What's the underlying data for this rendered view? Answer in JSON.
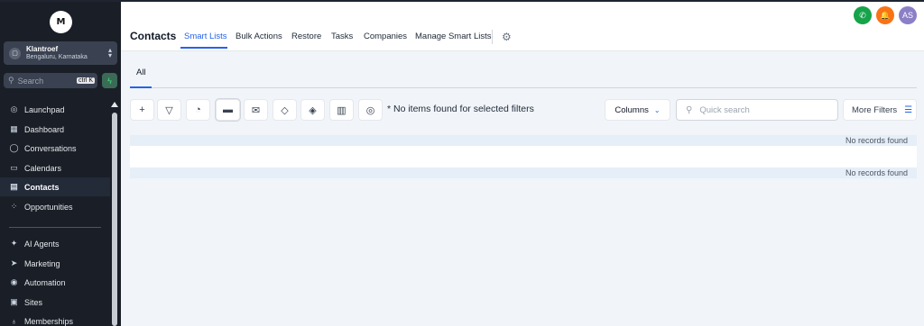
{
  "sidebar": {
    "logo_text": "M",
    "account": {
      "name": "Klantroef",
      "location": "Bengaluru, Karnataka"
    },
    "search": {
      "placeholder": "Search",
      "shortcut": "ctrl K"
    },
    "items": [
      {
        "label": "Launchpad",
        "icon": "rocket-icon",
        "glyph": "◎"
      },
      {
        "label": "Dashboard",
        "icon": "grid-icon",
        "glyph": "▦"
      },
      {
        "label": "Conversations",
        "icon": "chat-icon",
        "glyph": "◯"
      },
      {
        "label": "Calendars",
        "icon": "calendar-icon",
        "glyph": "▭"
      },
      {
        "label": "Contacts",
        "icon": "contacts-icon",
        "glyph": "▤"
      },
      {
        "label": "Opportunities",
        "icon": "opportunities-icon",
        "glyph": "⁘"
      },
      {
        "label": "AI Agents",
        "icon": "sparkle-icon",
        "glyph": "✦"
      },
      {
        "label": "Marketing",
        "icon": "send-icon",
        "glyph": "➤"
      },
      {
        "label": "Automation",
        "icon": "automation-icon",
        "glyph": "◉"
      },
      {
        "label": "Sites",
        "icon": "sites-icon",
        "glyph": "▣"
      },
      {
        "label": "Memberships",
        "icon": "memberships-icon",
        "glyph": "♁"
      }
    ],
    "active_item": "Contacts"
  },
  "header": {
    "title": "Contacts",
    "tabs": [
      {
        "label": "Smart Lists"
      },
      {
        "label": "Bulk Actions"
      },
      {
        "label": "Restore"
      },
      {
        "label": "Tasks"
      },
      {
        "label": "Companies"
      },
      {
        "label": "Manage Smart Lists"
      }
    ],
    "active_tab": "Smart Lists",
    "avatar_initials": "AS",
    "colors": {
      "phone": "#16a34a",
      "bell": "#f97316",
      "avatar": "#8b7fc7",
      "accent": "#2563eb"
    }
  },
  "main": {
    "tab": "All",
    "empty_message": "* No items found for selected filters",
    "columns_label": "Columns",
    "search_placeholder": "Quick search",
    "more_filters_label": "More Filters",
    "toolbar_icons": [
      "plus-icon",
      "filter-icon",
      "pipeline-icon",
      "message-icon",
      "email-icon",
      "add-tag-icon",
      "remove-tag-icon",
      "building-icon",
      "whatsapp-icon"
    ],
    "rows": [
      {
        "text": "No records found"
      },
      {
        "text": ""
      },
      {
        "text": "No records found"
      }
    ]
  }
}
